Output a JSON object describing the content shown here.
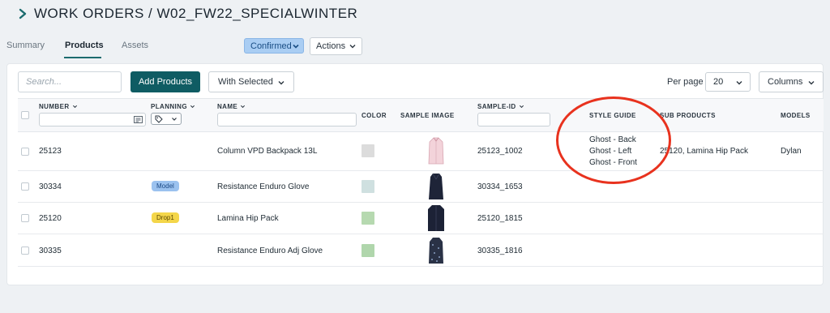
{
  "header": {
    "title": "WORK ORDERS / W02_FW22_SPECIALWINTER"
  },
  "tabs": [
    {
      "label": "Summary",
      "active": false
    },
    {
      "label": "Products",
      "active": true
    },
    {
      "label": "Assets",
      "active": false
    }
  ],
  "status": {
    "label": "Confirmed",
    "color": "#a9cdf3"
  },
  "actions": {
    "label": "Actions"
  },
  "toolbar": {
    "search_placeholder": "Search...",
    "add_label": "Add Products",
    "with_selected_label": "With Selected",
    "per_page_label": "Per page",
    "per_page_value": "20",
    "columns_label": "Columns"
  },
  "columns": {
    "number": "NUMBER",
    "planning": "PLANNING",
    "name": "NAME",
    "color": "COLOR",
    "sample_image": "SAMPLE IMAGE",
    "sample_id": "SAMPLE-ID",
    "style_guide": "STYLE GUIDE",
    "sub_products": "SUB PRODUCTS",
    "models": "MODELS"
  },
  "rows": [
    {
      "number": "25123",
      "planning": "",
      "name": "Column VPD Backpack 13L",
      "color": "#dcdcdc",
      "image": "pink-shirt",
      "sample_id": "25123_1002",
      "style_guide": [
        "Ghost - Back",
        "Ghost - Left",
        "Ghost - Front"
      ],
      "sub_products": "25120, Lamina Hip Pack",
      "models": "Dylan"
    },
    {
      "number": "30334",
      "planning": "Model",
      "name": "Resistance Enduro Glove",
      "color": "#cfe0e0",
      "image": "navy-coat",
      "sample_id": "30334_1653",
      "style_guide": [],
      "sub_products": "",
      "models": ""
    },
    {
      "number": "25120",
      "planning": "Drop1",
      "name": "Lamina Hip Pack",
      "color": "#b6d9b0",
      "image": "navy-jacket",
      "sample_id": "25120_1815",
      "style_guide": [],
      "sub_products": "",
      "models": ""
    },
    {
      "number": "30335",
      "planning": "",
      "name": "Resistance Enduro Adj Glove",
      "color": "#b0d6ac",
      "image": "floral-dress",
      "sample_id": "30335_1816",
      "style_guide": [],
      "sub_products": "",
      "models": ""
    }
  ],
  "colors": {
    "accent": "#0f5c63",
    "highlight_circle": "#e8321e"
  }
}
